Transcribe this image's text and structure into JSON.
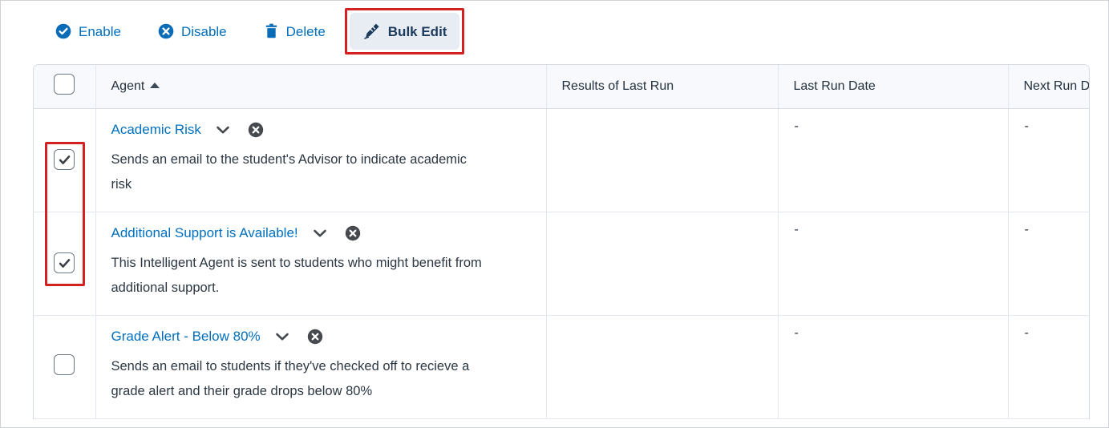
{
  "toolbar": {
    "buttons": [
      {
        "label": "Enable",
        "icon": "check-circle-icon"
      },
      {
        "label": "Disable",
        "icon": "x-circle-icon"
      },
      {
        "label": "Delete",
        "icon": "trash-icon"
      },
      {
        "label": "Bulk Edit",
        "icon": "pencil-edit-icon"
      }
    ]
  },
  "table": {
    "columns": [
      {
        "key": "select",
        "label": ""
      },
      {
        "key": "agent",
        "label": "Agent",
        "sort": "ascending"
      },
      {
        "key": "results",
        "label": "Results of Last Run"
      },
      {
        "key": "lastrun",
        "label": "Last Run Date"
      },
      {
        "key": "nextrun",
        "label": "Next Run Date"
      }
    ],
    "header_select_all_checked": false,
    "rows": [
      {
        "checked": true,
        "name": "Academic Risk",
        "description": "Sends an email to the student's Advisor to indicate academic risk",
        "status_icon": "x-circle-dark-icon",
        "results_of_last_run": "",
        "last_run_date": "-",
        "next_run_date": "-"
      },
      {
        "checked": true,
        "name": "Additional Support is Available!",
        "description": "This Intelligent Agent is sent to students who might benefit from additional support.",
        "status_icon": "x-circle-dark-icon",
        "results_of_last_run": "",
        "last_run_date": "-",
        "next_run_date": "-"
      },
      {
        "checked": false,
        "name": "Grade Alert - Below 80%",
        "description": "Sends an email to students if they've checked off to recieve a grade alert and their grade drops below 80%",
        "status_icon": "x-circle-dark-icon",
        "results_of_last_run": "",
        "last_run_date": "-",
        "next_run_date": "-"
      }
    ]
  },
  "annotations": {
    "highlight_color": "#d32020",
    "targets": [
      "bulk-edit-button",
      "selected-row-checkboxes"
    ]
  },
  "colors": {
    "link": "#006fbf",
    "toolbar_icon": "#0a6cb6",
    "header_bg": "#f7f9fc",
    "status_dark": "#46494d",
    "bulk_edit_bg": "#e8edf3",
    "bulk_edit_text": "#1b3a5c"
  }
}
